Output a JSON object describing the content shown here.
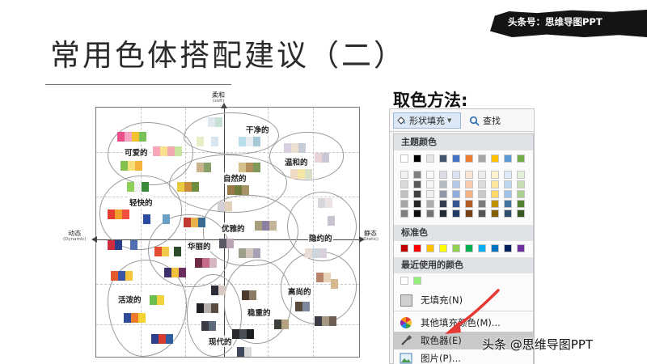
{
  "watermark": {
    "text": "头条号：思维导图PPT"
  },
  "slide": {
    "title": "常用色体搭配建议（二）"
  },
  "chart": {
    "axes": {
      "top": {
        "label": "柔和",
        "sub": "(soft)"
      },
      "left": {
        "label": "动态",
        "sub": "(Dynamic)"
      },
      "right": {
        "label": "静态",
        "sub": "(Static)"
      }
    },
    "groups": [
      {
        "name": "可爱的"
      },
      {
        "name": "干净的"
      },
      {
        "name": "温和的"
      },
      {
        "name": "自然的"
      },
      {
        "name": "轻快的"
      },
      {
        "name": "优雅的"
      },
      {
        "name": "隐约的"
      },
      {
        "name": "华丽的"
      },
      {
        "name": "高尚的"
      },
      {
        "name": "活泼的"
      },
      {
        "name": "稳重的"
      },
      {
        "name": "现代的"
      }
    ]
  },
  "method": {
    "title": "取色方法:"
  },
  "ribbon": {
    "shape_fill": "形状填充",
    "find": "查找",
    "theme_colors": "主题颜色",
    "standard_colors": "标准色",
    "recent_colors": "最近使用的颜色",
    "no_fill": "无填充(N)",
    "more_colors": "其他填充颜色(M)...",
    "eyedropper": "取色器(E)",
    "picture": "图片(P)..."
  },
  "palette": {
    "theme_top": [
      "#ffffff",
      "#000000",
      "#e7e6e6",
      "#44546a",
      "#4472c4",
      "#ed7d31",
      "#a5a5a5",
      "#ffc000",
      "#5b9bd5",
      "#70ad47"
    ],
    "standard": [
      "#c00000",
      "#ff0000",
      "#ffc000",
      "#ffff00",
      "#92d050",
      "#00b050",
      "#00b0f0",
      "#0070c0",
      "#002060",
      "#7030a0"
    ],
    "recent": [
      "#ffffff",
      "#92f07a"
    ],
    "accent": "#e53935"
  },
  "footer": {
    "credit": "头条 @思维导图PPT"
  }
}
